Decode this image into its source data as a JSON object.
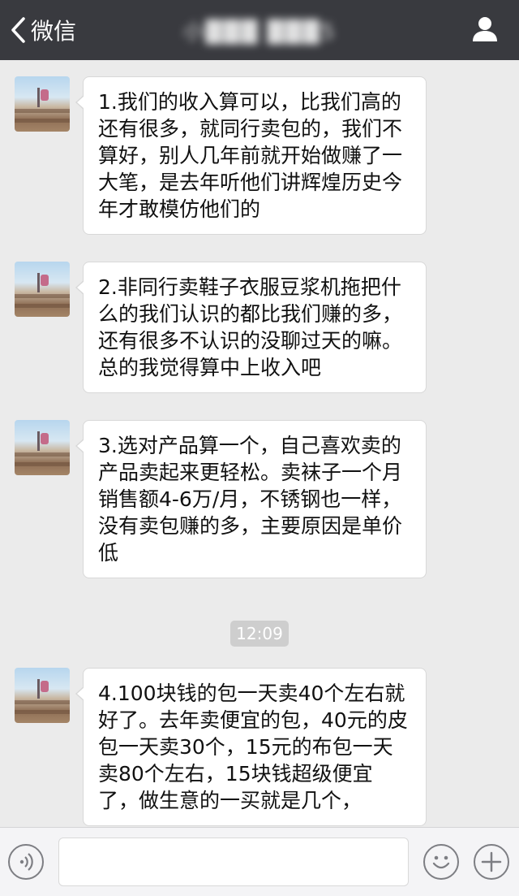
{
  "header": {
    "back_label": "微信",
    "title": "小███ ███5",
    "profile_icon": "person-icon"
  },
  "messages": [
    {
      "text": "1.我们的收入算可以，比我们高的还有很多，就同行卖包的，我们不算好，别人几年前就开始做赚了一大笔，是去年听他们讲辉煌历史今年才敢模仿他们的"
    },
    {
      "text": "2.非同行卖鞋子衣服豆浆机拖把什么的我们认识的都比我们赚的多，还有很多不认识的没聊过天的嘛。总的我觉得算中上收入吧"
    },
    {
      "text": "3.选对产品算一个，自己喜欢卖的产品卖起来更轻松。卖袜子一个月销售额4-6万/月，不锈钢也一样，没有卖包赚的多，主要原因是单价低"
    },
    {
      "text": "4.100块钱的包一天卖40个左右就好了。去年卖便宜的包，40元的皮包一天卖30个，15元的布包一天卖80个左右，15块钱超级便宜了，做生意的一买就是几个，"
    }
  ],
  "timestamp": "12:09",
  "input": {
    "value": "",
    "voice_icon": "voice-icon",
    "emoji_icon": "emoji-icon",
    "plus_icon": "plus-icon"
  },
  "colors": {
    "header_bg": "#393a3f",
    "chat_bg": "#ebebeb",
    "bubble_bg": "#ffffff",
    "timestamp_bg": "#cecece"
  }
}
